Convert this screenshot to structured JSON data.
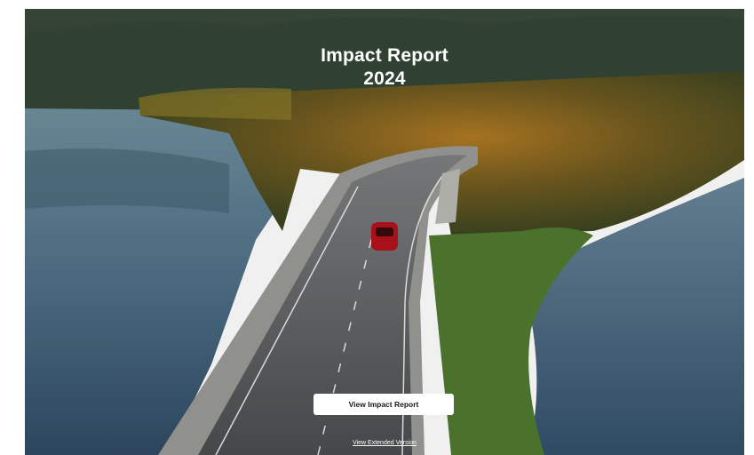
{
  "hero": {
    "title_line1": "Impact Report",
    "title_line2": "2024",
    "primary_button": "View Impact Report",
    "secondary_link": "View Extended Version"
  },
  "colors": {
    "page_background": "#ffffff",
    "button_background": "#ffffff",
    "button_text": "#171a20",
    "title_text": "#ffffff"
  }
}
